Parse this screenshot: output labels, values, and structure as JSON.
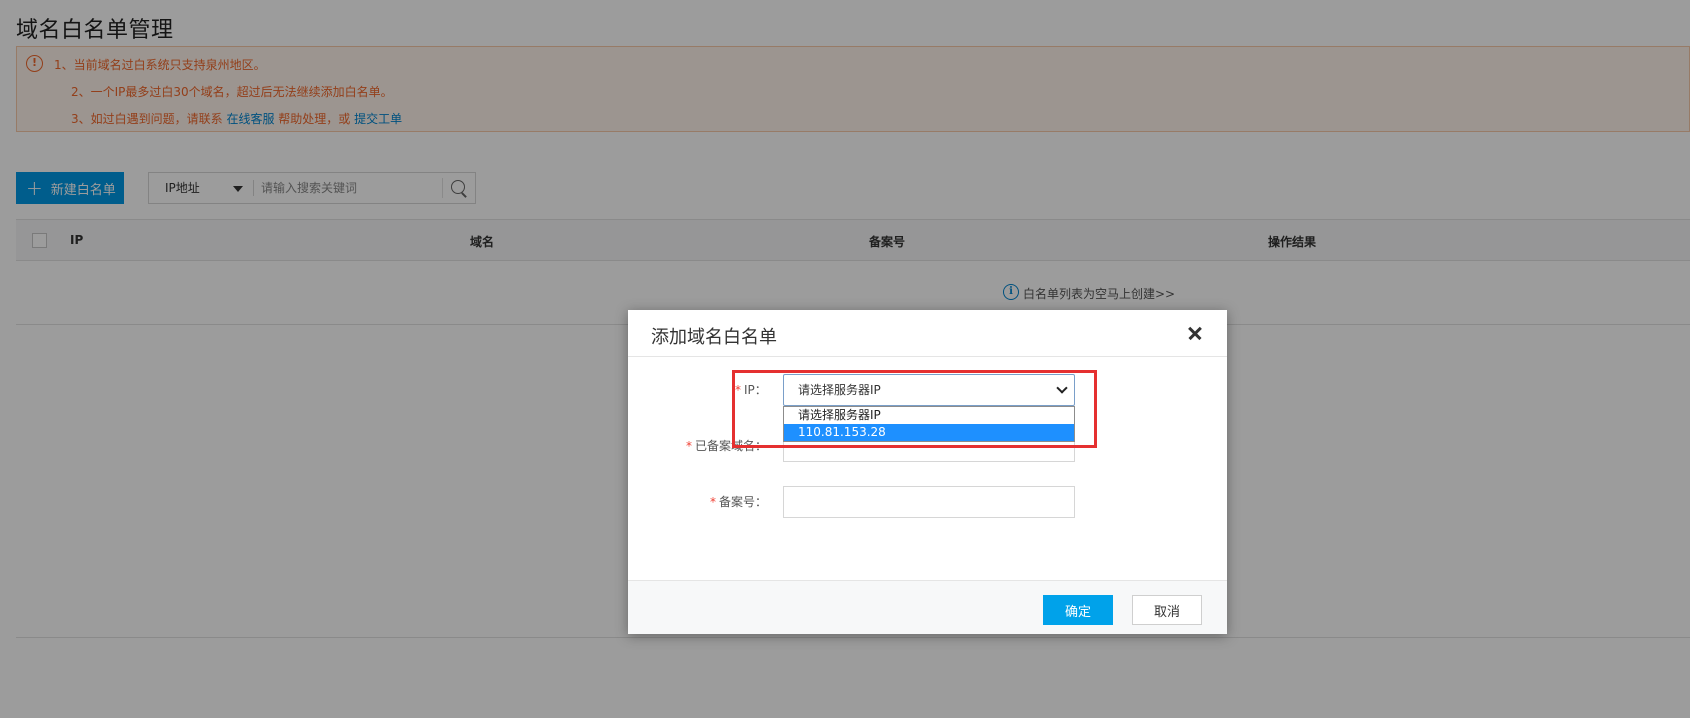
{
  "page": {
    "title": "域名白名单管理"
  },
  "notice": {
    "line1": "1、当前域名过白系统只支持泉州地区。",
    "line2": "2、一个IP最多过白30个域名，超过后无法继续添加白名单。",
    "line3_prefix": "3、如过白遇到问题，请联系 ",
    "line3_link1": "在线客服",
    "line3_mid": " 帮助处理，或 ",
    "line3_link2": "提交工单",
    "icon": "warning-circle-icon"
  },
  "toolbar": {
    "new_button": "新建白名单",
    "search_type": "IP地址",
    "search_placeholder": "请输入搜索关键词"
  },
  "table": {
    "columns": [
      "IP",
      "域名",
      "备案号",
      "操作结果"
    ],
    "empty_text": "白名单列表为空马上创建>>"
  },
  "modal": {
    "title": "添加域名白名单",
    "ip_label": "IP：",
    "domain_label": "已备案域名：",
    "record_label": "备案号：",
    "ip_select_value": "请选择服务器IP",
    "ip_options": [
      "请选择服务器IP",
      "110.81.153.28"
    ],
    "ok_button": "确定",
    "cancel_button": "取消"
  },
  "colors": {
    "accent": "#0099e5",
    "warning": "#f0672b",
    "highlight": "#e53030"
  }
}
